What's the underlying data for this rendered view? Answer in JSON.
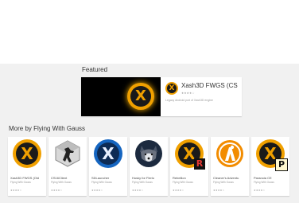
{
  "colors": {
    "accent_orange": "#f0a000",
    "dark": "#1a1a1a",
    "blue_orb": "#1565c0",
    "background": "#f1f1f1"
  },
  "featured": {
    "section_title": "Featured",
    "app_name": "Xash3D FWGS (CS",
    "stars": "★★★★☆",
    "description": "Legacy Android port of Xash3D engine"
  },
  "more_by": {
    "section_title": "More by Flying With Gauss",
    "apps": [
      {
        "name": "Xash3D FWGS (Old",
        "developer": "Flying With Gauss",
        "stars": "★★★★☆",
        "icon": "xash-orange-icon"
      },
      {
        "name": "CS16Client",
        "developer": "Flying With Gauss",
        "stars": "★★★★☆",
        "icon": "counter-strike-icon"
      },
      {
        "name": "SDLauncher",
        "developer": "Flying With Gauss",
        "stars": "★★★★☆",
        "icon": "xash-blue-icon"
      },
      {
        "name": "Husky for Flerlo",
        "developer": "Flying With Gauss",
        "stars": "★★★★☆",
        "icon": "husky-icon"
      },
      {
        "name": "Rebellion",
        "developer": "Flying With Gauss",
        "stars": "★★★★☆",
        "icon": "rebellion-icon"
      },
      {
        "name": "Cleaner's Adventu",
        "developer": "Flying With Gauss",
        "stars": "★★★★☆",
        "icon": "cleaners-adventure-icon"
      },
      {
        "name": "Paranoia CE",
        "developer": "Flying With Gauss",
        "stars": "★★★★☆",
        "icon": "paranoia-icon"
      }
    ]
  }
}
